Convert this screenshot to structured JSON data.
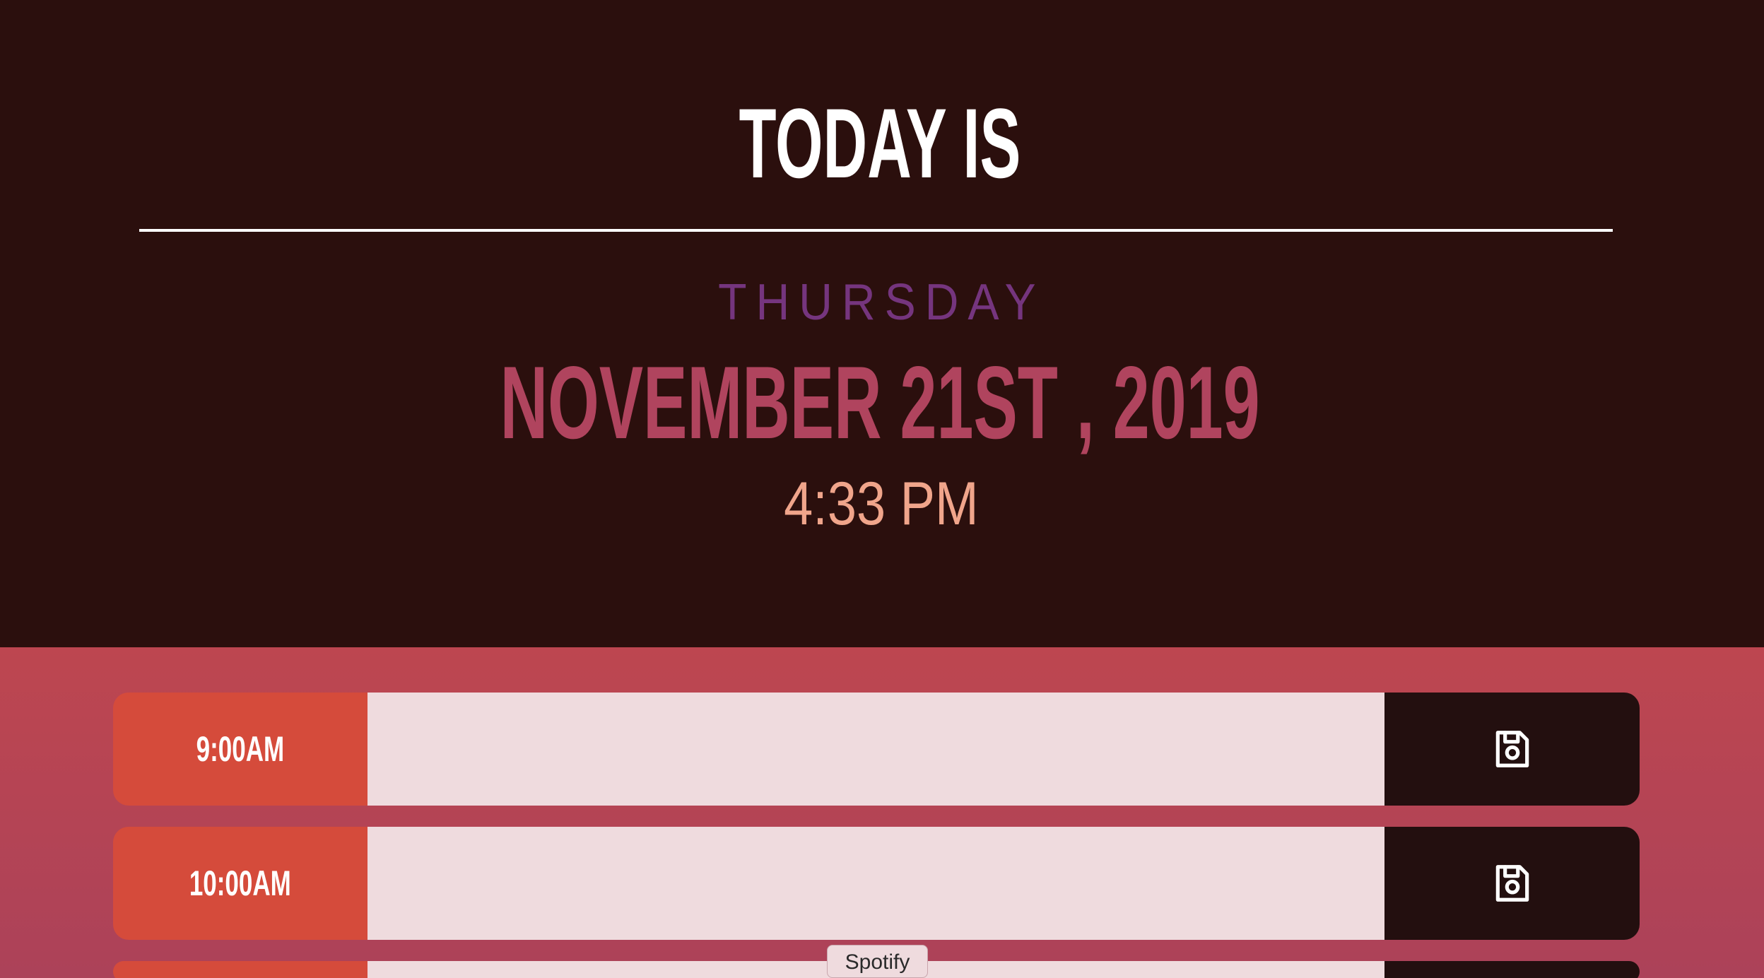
{
  "app": {
    "title": "TODAY IS",
    "weekday": "THURSDAY",
    "date": "NOVEMBER 21ST , 2019",
    "time": "4:33 PM"
  },
  "planner": {
    "rows": [
      {
        "hour": "9:00AM",
        "event_value": "",
        "event_placeholder": "",
        "save_icon": "save-icon"
      },
      {
        "hour": "10:00AM",
        "event_value": "",
        "event_placeholder": "",
        "save_icon": "save-icon"
      }
    ]
  },
  "tooltip": {
    "label": "Spotify"
  },
  "colors": {
    "background": "#2b0f0d",
    "title": "#ffffff",
    "weekday": "#75357e",
    "date": "#b0445e",
    "time": "#f0a58b",
    "hour_label": "#d54b3b",
    "input": "#efdbde",
    "save_button": "#230f0f",
    "planner_background": "#bd4650"
  }
}
